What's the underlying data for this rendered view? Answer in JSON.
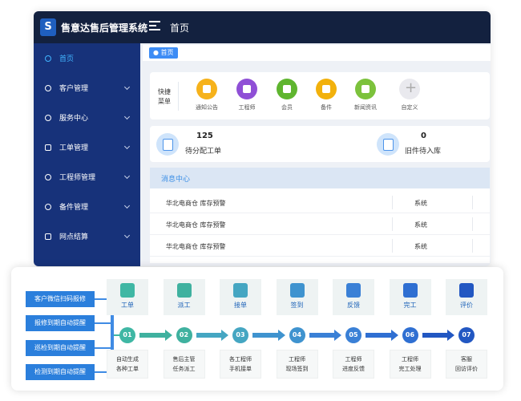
{
  "app": {
    "title": "售意达售后管理系统",
    "top_home": "首页",
    "logo_letter": "S"
  },
  "sidebar": {
    "items": [
      {
        "label": "首页",
        "active": true
      },
      {
        "label": "客户管理"
      },
      {
        "label": "服务中心"
      },
      {
        "label": "工单管理"
      },
      {
        "label": "工程师管理"
      },
      {
        "label": "备件管理"
      },
      {
        "label": "网点结算"
      }
    ]
  },
  "breadcrumb": {
    "current": "● 首页"
  },
  "quick_menu": {
    "label": "快捷菜单",
    "items": [
      {
        "label": "通知公告",
        "color": "#f6b21b"
      },
      {
        "label": "工程师",
        "color": "#8f4fd6"
      },
      {
        "label": "会员",
        "color": "#5fb52f"
      },
      {
        "label": "备件",
        "color": "#f2b10c"
      },
      {
        "label": "新闻资讯",
        "color": "#7cc23c"
      },
      {
        "label": "自定义",
        "color": "#e9e9ee"
      }
    ]
  },
  "stats": [
    {
      "value": "125",
      "label": "待分配工单"
    },
    {
      "value": "0",
      "label": "旧件待入库"
    }
  ],
  "messages": {
    "title": "消息中心",
    "rows": [
      {
        "content": "华北电商仓 库存预警",
        "type": "系统"
      },
      {
        "content": "华北电商仓 库存预警",
        "type": "系统"
      },
      {
        "content": "华北电商仓 库存预警",
        "type": "系统"
      }
    ]
  },
  "process": {
    "entries": [
      "客户微信扫码报修",
      "报修到期自动提醒",
      "巡检到期自动提醒",
      "检测到期自动提醒"
    ],
    "steps": [
      {
        "name": "工单",
        "num": "01",
        "desc1": "自动生成",
        "desc2": "各种工单",
        "color": "#3fb7a4"
      },
      {
        "name": "派工",
        "num": "02",
        "desc1": "售后主管",
        "desc2": "任务派工",
        "color": "#3fb19f"
      },
      {
        "name": "接单",
        "num": "03",
        "desc1": "各工程师",
        "desc2": "手机接单",
        "color": "#45a6c2"
      },
      {
        "name": "签到",
        "num": "04",
        "desc1": "工程师",
        "desc2": "现场签到",
        "color": "#3f93cf"
      },
      {
        "name": "反馈",
        "num": "05",
        "desc1": "工程师",
        "desc2": "进度反馈",
        "color": "#3a80d6"
      },
      {
        "name": "完工",
        "num": "06",
        "desc1": "工程师",
        "desc2": "完工处理",
        "color": "#2f6fd2"
      },
      {
        "name": "评价",
        "num": "07",
        "desc1": "客服",
        "desc2": "回访评价",
        "color": "#2257c2"
      }
    ]
  }
}
